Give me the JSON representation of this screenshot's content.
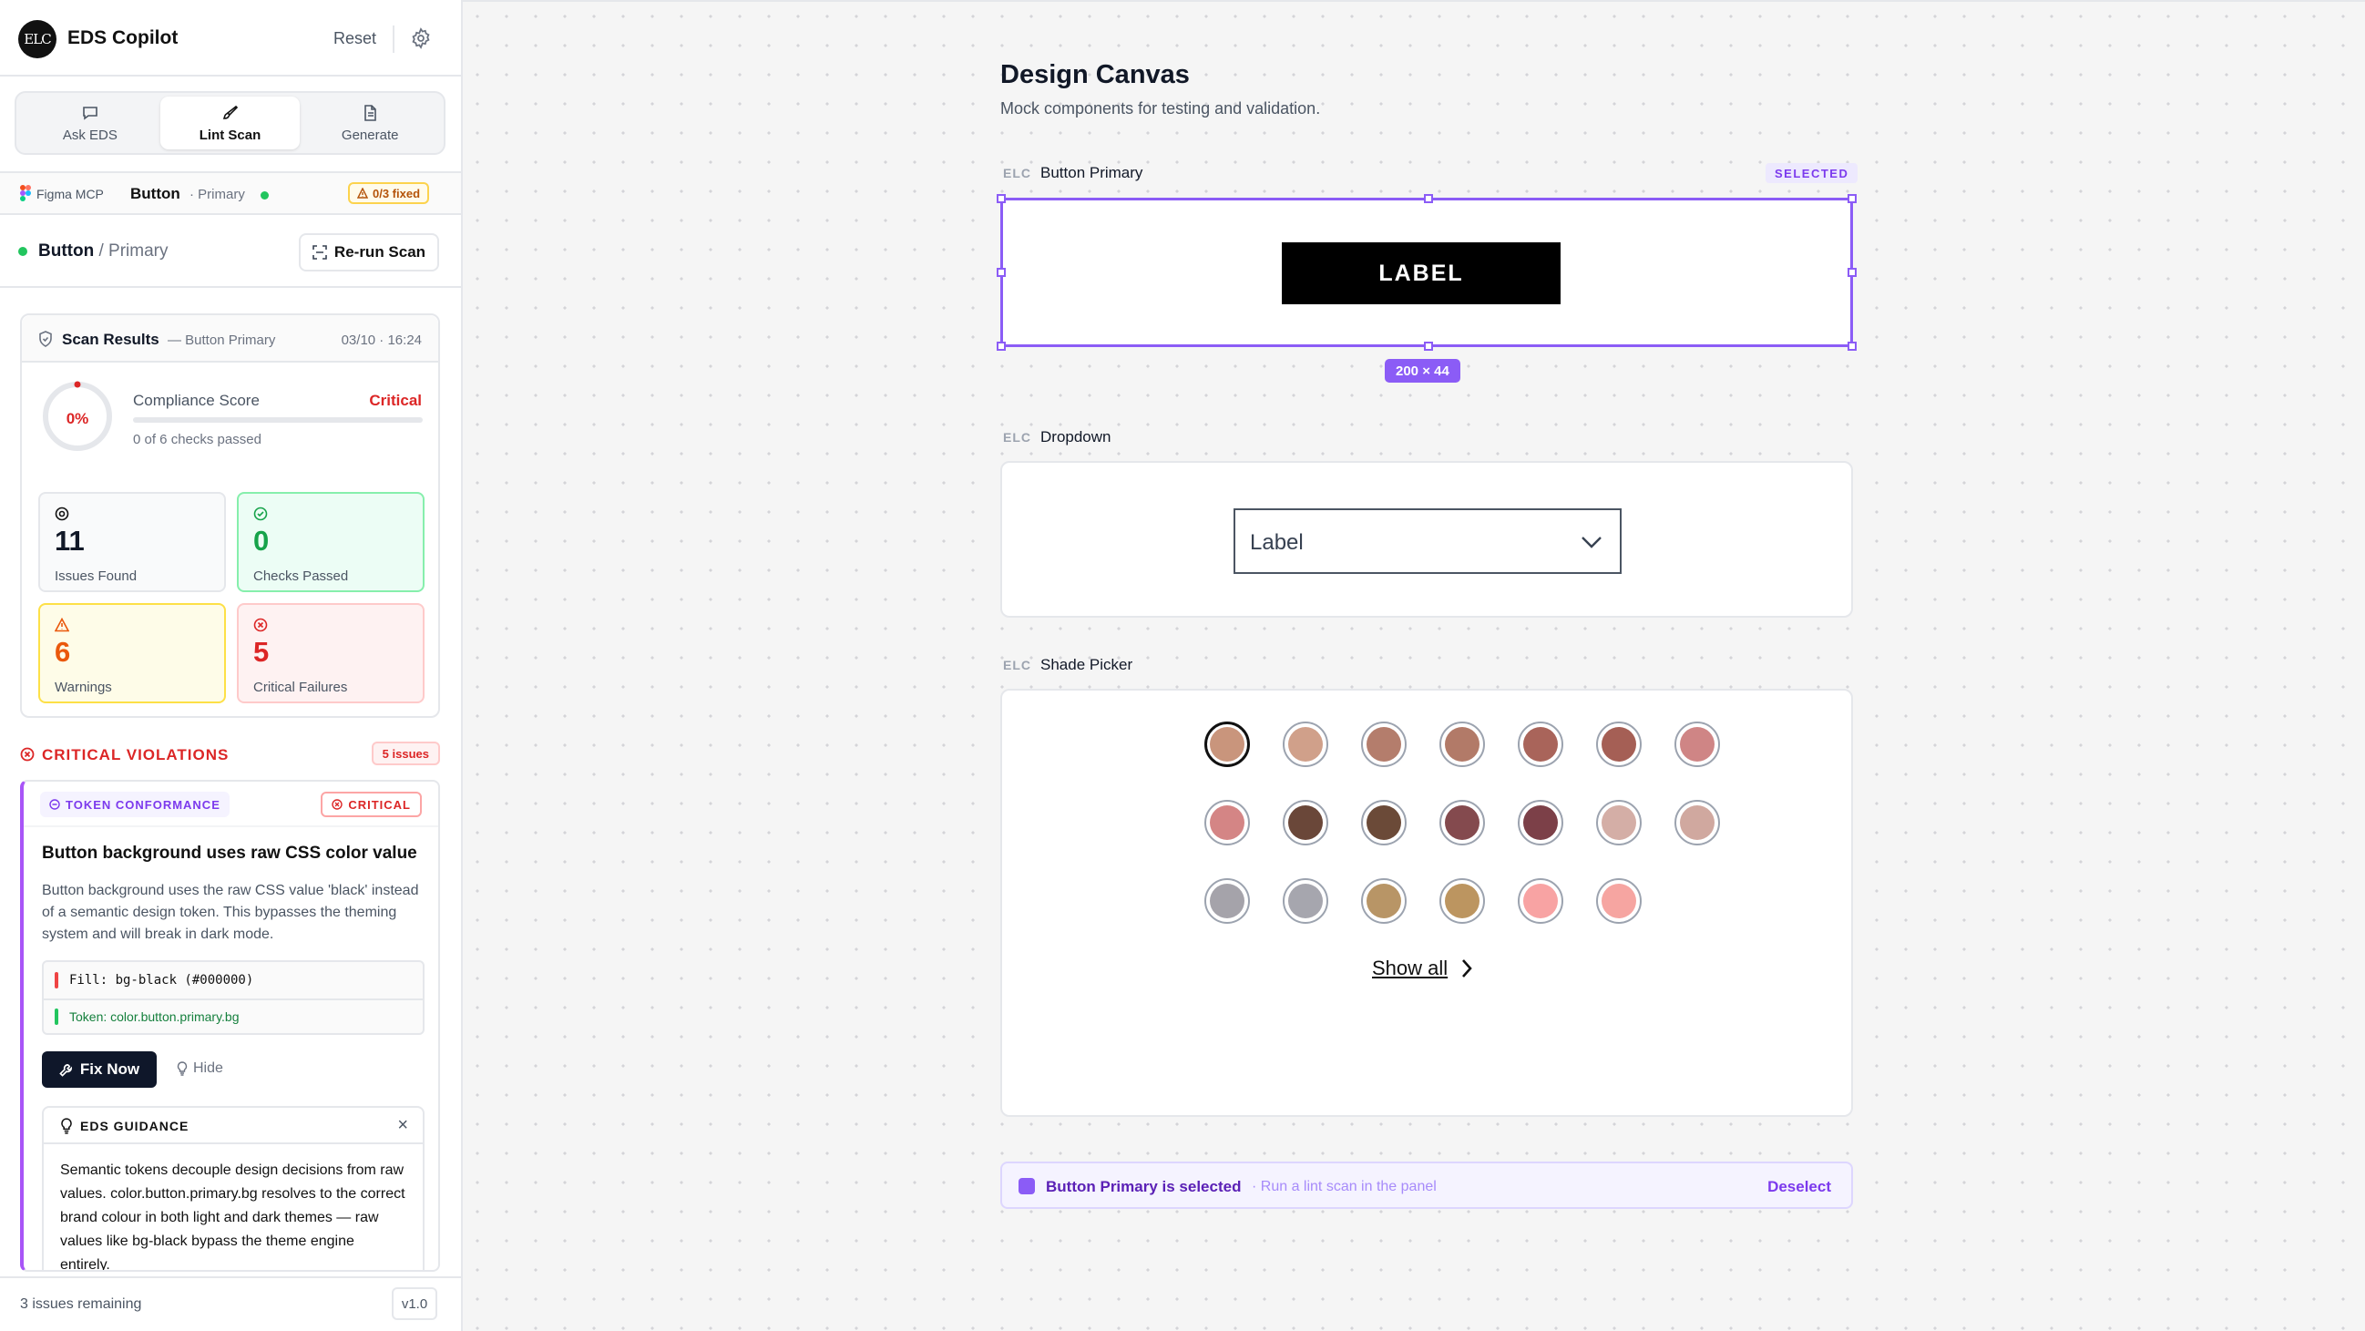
{
  "header": {
    "logo_text": "ELC",
    "app_title": "EDS Copilot",
    "reset_label": "Reset",
    "settings_icon": "gear-icon"
  },
  "tabs": [
    {
      "label": "Ask EDS",
      "icon": "chat-bubble-icon",
      "active": false
    },
    {
      "label": "Lint Scan",
      "icon": "brush-icon",
      "active": true
    },
    {
      "label": "Generate",
      "icon": "document-icon",
      "active": false
    }
  ],
  "mcp_bar": {
    "source": "Figma MCP",
    "component": "Button",
    "variant": "· Primary",
    "fixed_badge": "0/3 fixed"
  },
  "component_row": {
    "name": "Button",
    "separator": " / ",
    "variant": "Primary",
    "rerun_label": "Re-run Scan"
  },
  "scan": {
    "title": "Scan Results",
    "subtitle": "— Button Primary",
    "timestamp": "03/10 · 16:24",
    "score_value": "0%",
    "score_fraction": 0,
    "score_label": "Compliance Score",
    "score_status": "Critical",
    "checks_text": "0 of 6 checks passed",
    "stats": {
      "issues": {
        "value": "11",
        "label": "Issues Found"
      },
      "passed": {
        "value": "0",
        "label": "Checks Passed"
      },
      "warnings": {
        "value": "6",
        "label": "Warnings"
      },
      "critical": {
        "value": "5",
        "label": "Critical Failures"
      }
    }
  },
  "violations": {
    "section_title": "CRITICAL VIOLATIONS",
    "count_badge": "5 issues",
    "items": [
      {
        "category": "TOKEN CONFORMANCE",
        "severity": "CRITICAL",
        "title": "Button background uses raw CSS color value",
        "description": "Button background uses the raw CSS value 'black' instead of a semantic design token. This bypasses the theming system and will break in dark mode.",
        "fill_code": "Fill: bg-black (#000000)",
        "token_code": "Token: color.button.primary.bg",
        "fix_label": "Fix Now",
        "hide_label": "Hide",
        "guidance_title": "EDS GUIDANCE",
        "guidance_text": "Semantic tokens decouple design decisions from raw values. color.button.primary.bg resolves to the correct brand colour in both light and dark themes — raw values like bg-black bypass the theme engine entirely."
      }
    ]
  },
  "footer": {
    "remaining": "3 issues remaining",
    "version": "v1.0"
  },
  "canvas": {
    "title": "Design Canvas",
    "subtitle": "Mock components for testing and validation.",
    "elc_tag": "ELC",
    "button_frame": {
      "name": "Button Primary",
      "selected_badge": "SELECTED",
      "button_label": "LABEL",
      "dimensions": "200 × 44"
    },
    "dropdown_frame": {
      "name": "Dropdown",
      "dropdown_label": "Label"
    },
    "shade_frame": {
      "name": "Shade Picker",
      "show_all": "Show all",
      "selected_index": 0,
      "swatches": [
        "#c9957c",
        "#d0a08a",
        "#b47d6c",
        "#b27a68",
        "#a9645a",
        "#a55f55",
        "#cf8585",
        "#d48585",
        "#6a4739",
        "#6b4a38",
        "#844a4e",
        "#7c4048",
        "#d4aea6",
        "#d0a89f",
        "#a5a3aa",
        "#a6a6ae",
        "#b89566",
        "#bc9560",
        "#f8a3a3",
        "#f6a5a1"
      ]
    },
    "status_bar": {
      "main": "Button Primary is selected",
      "hint": "· Run a lint scan in the panel",
      "deselect": "Deselect"
    }
  },
  "colors": {
    "accent": "#8b5cf6",
    "critical": "#dc2626",
    "success": "#16a34a",
    "warning": "#ea580c"
  }
}
